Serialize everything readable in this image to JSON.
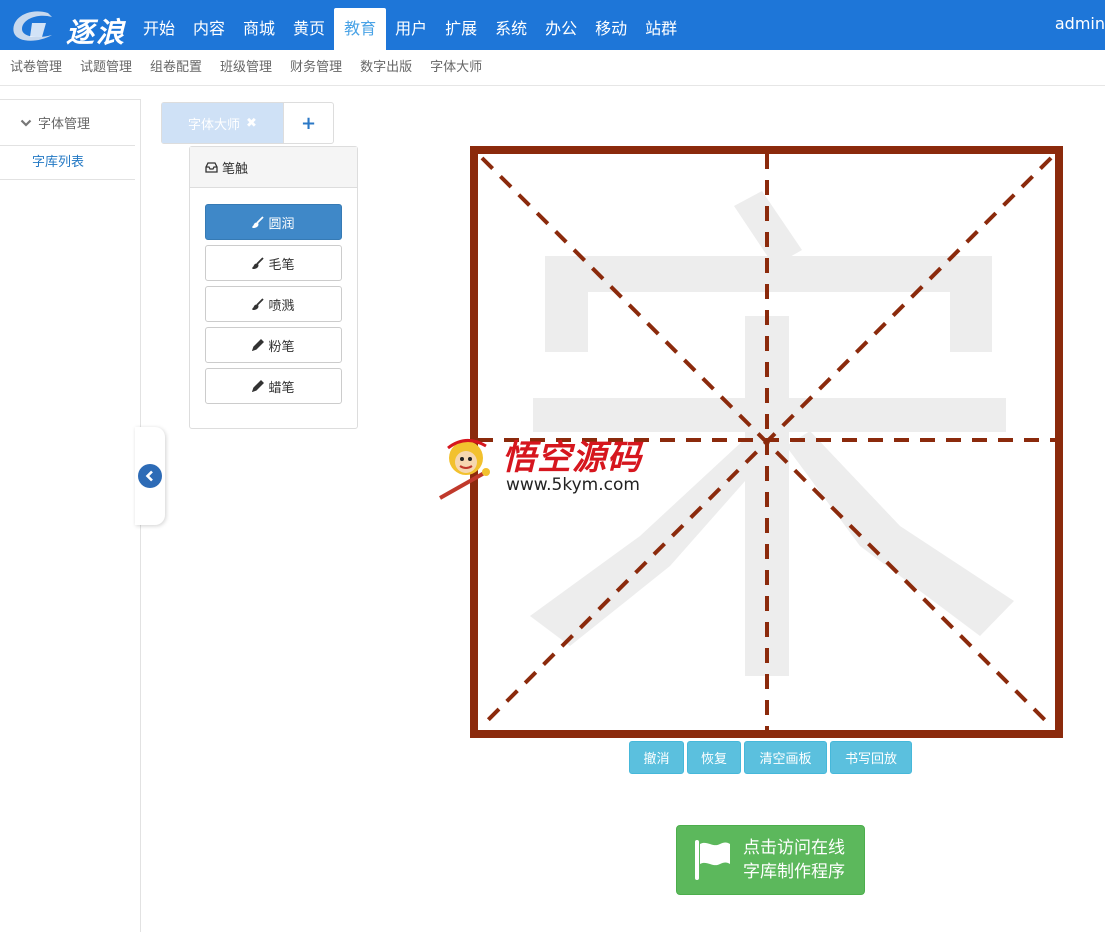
{
  "header": {
    "logo_text": "逐浪",
    "nav": [
      "开始",
      "内容",
      "商城",
      "黄页",
      "教育",
      "用户",
      "扩展",
      "系统",
      "办公",
      "移动",
      "站群"
    ],
    "active_nav": "教育",
    "user": "admin"
  },
  "subnav": [
    "试卷管理",
    "试题管理",
    "组卷配置",
    "班级管理",
    "财务管理",
    "数字出版",
    "字体大师"
  ],
  "sidebar": {
    "group_label": "字体管理",
    "links": [
      "字库列表"
    ]
  },
  "tabs": {
    "active_label": "字体大师",
    "close_glyph": "✖",
    "add_glyph": "+"
  },
  "brush_panel": {
    "title": "笔触",
    "brushes": [
      "圆润",
      "毛笔",
      "喷溅",
      "粉笔",
      "蜡笔"
    ],
    "selected": "圆润"
  },
  "canvas": {
    "reference_char": "宋",
    "frame_color": "#8b2a0c",
    "char_color": "#ededed"
  },
  "actions": [
    "撤消",
    "恢复",
    "清空画板",
    "书写回放"
  ],
  "visit_button": {
    "line1": "点击访问在线",
    "line2": "字库制作程序"
  },
  "watermark": {
    "title": "悟空源码",
    "url": "www.5kym.com"
  },
  "colors": {
    "topbar": "#1e76d8",
    "active_nav_text": "#4aa3e6",
    "brush_active": "#3f88c8",
    "action_button": "#5bc0de",
    "visit_button": "#5cb85c"
  }
}
